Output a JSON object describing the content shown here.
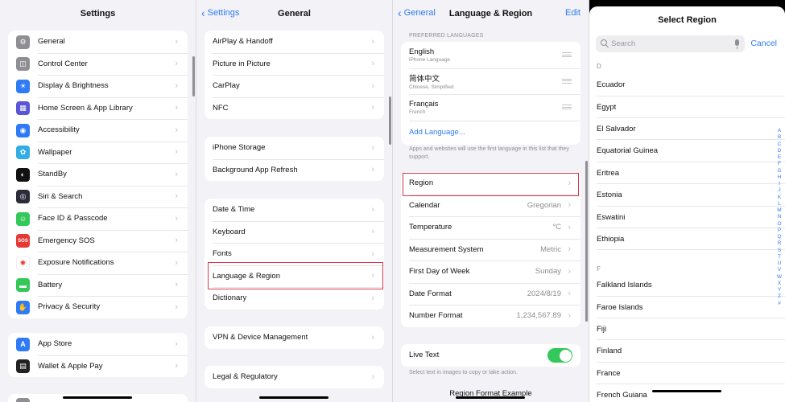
{
  "settings": {
    "title": "Settings",
    "items": [
      {
        "label": "General",
        "icon": "gear-icon",
        "color": "#8e8e93",
        "glyph": "⚙"
      },
      {
        "label": "Control Center",
        "icon": "switches-icon",
        "color": "#8e8e93",
        "glyph": "◫"
      },
      {
        "label": "Display & Brightness",
        "icon": "sun-icon",
        "color": "#2f7bf6",
        "glyph": "☀"
      },
      {
        "label": "Home Screen & App Library",
        "icon": "grid-icon",
        "color": "#5856d6",
        "glyph": "▦"
      },
      {
        "label": "Accessibility",
        "icon": "accessibility-icon",
        "color": "#2f7bf6",
        "glyph": "◉"
      },
      {
        "label": "Wallpaper",
        "icon": "flower-icon",
        "color": "#32ade6",
        "glyph": "✿"
      },
      {
        "label": "StandBy",
        "icon": "standby-icon",
        "color": "#111111",
        "glyph": "◐"
      },
      {
        "label": "Siri & Search",
        "icon": "siri-icon",
        "color": "#2b2b3a",
        "glyph": "◎"
      },
      {
        "label": "Face ID & Passcode",
        "icon": "face-id-icon",
        "color": "#34c759",
        "glyph": "☺"
      },
      {
        "label": "Emergency SOS",
        "icon": "sos-icon",
        "color": "#e53935",
        "glyph": "SOS"
      },
      {
        "label": "Exposure Notifications",
        "icon": "exposure-icon",
        "color": "#ffffff",
        "glyph": "✺"
      },
      {
        "label": "Battery",
        "icon": "battery-icon",
        "color": "#34c759",
        "glyph": "▬"
      },
      {
        "label": "Privacy & Security",
        "icon": "hand-icon",
        "color": "#2f7bf6",
        "glyph": "✋"
      }
    ],
    "items2": [
      {
        "label": "App Store",
        "icon": "app-store-icon",
        "color": "#2f7bf6",
        "glyph": "A"
      },
      {
        "label": "Wallet & Apple Pay",
        "icon": "wallet-icon",
        "color": "#222222",
        "glyph": "▤"
      }
    ]
  },
  "general": {
    "back": "Settings",
    "title": "General",
    "group1": [
      "AirPlay & Handoff",
      "Picture in Picture",
      "CarPlay",
      "NFC"
    ],
    "group2": [
      "iPhone Storage",
      "Background App Refresh"
    ],
    "group3": [
      "Date & Time",
      "Keyboard",
      "Fonts",
      "Language & Region",
      "Dictionary"
    ],
    "group4": [
      "VPN & Device Management"
    ],
    "group5": [
      "Legal & Regulatory"
    ]
  },
  "language": {
    "back": "General",
    "title": "Language & Region",
    "edit": "Edit",
    "preferred_header": "PREFERRED LANGUAGES",
    "languages": [
      {
        "name": "English",
        "sub": "iPhone Language"
      },
      {
        "name": "简体中文",
        "sub": "Chinese, Simplified"
      },
      {
        "name": "Français",
        "sub": "French"
      }
    ],
    "add_language": "Add Language...",
    "footnote": "Apps and websites will use the first language in this list that they support.",
    "settings": [
      {
        "label": "Region",
        "value": ""
      },
      {
        "label": "Calendar",
        "value": "Gregorian"
      },
      {
        "label": "Temperature",
        "value": "°C"
      },
      {
        "label": "Measurement System",
        "value": "Metric"
      },
      {
        "label": "First Day of Week",
        "value": "Sunday"
      },
      {
        "label": "Date Format",
        "value": "2024/8/19"
      },
      {
        "label": "Number Format",
        "value": "1,234,567.89"
      }
    ],
    "live_text": "Live Text",
    "live_text_note": "Select text in images to copy or take action.",
    "region_example": "Region Format Example"
  },
  "region": {
    "title": "Select Region",
    "search_placeholder": "Search",
    "cancel": "Cancel",
    "section_d": "D",
    "regions_d": [
      "Ecuador",
      "Egypt",
      "El Salvador",
      "Equatorial Guinea",
      "Eritrea",
      "Estonia",
      "Eswatini",
      "Ethiopia"
    ],
    "section_f": "F",
    "regions_f": [
      "Falkland Islands",
      "Faroe Islands",
      "Fiji",
      "Finland",
      "France",
      "French Guiana"
    ],
    "index": [
      "A",
      "B",
      "C",
      "D",
      "E",
      "F",
      "G",
      "H",
      "I",
      "J",
      "K",
      "L",
      "M",
      "N",
      "O",
      "P",
      "Q",
      "R",
      "S",
      "T",
      "U",
      "V",
      "W",
      "X",
      "Y",
      "Z",
      "#"
    ]
  }
}
